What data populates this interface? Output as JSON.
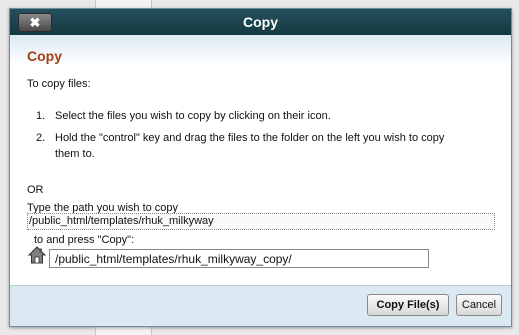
{
  "dialog": {
    "title": "Copy",
    "close_label": "✖",
    "heading": "Copy",
    "intro": "To copy files:",
    "steps": [
      {
        "num": "1.",
        "line1": "Select the files you wish to copy by clicking on their icon.",
        "line2": ""
      },
      {
        "num": "2.",
        "line1": "Hold the \"control\" key and drag the files to the folder on the left you wish to copy",
        "line2": "them to."
      }
    ],
    "or_label": "OR",
    "path_prompt": "Type the path you wish to copy",
    "source_path": "/public_html/templates/rhuk_milkyway",
    "press_label": "to and press \"Copy\":",
    "destination_value": "/public_html/templates/rhuk_milkyway_copy/",
    "copy_button": "Copy File(s)",
    "cancel_button": "Cancel"
  },
  "colors": {
    "titlebar": "#1c4650",
    "heading": "#a43e14",
    "body_tint": "#dbe9f3"
  },
  "icons": {
    "close": "close-icon",
    "destination": "house-icon"
  }
}
